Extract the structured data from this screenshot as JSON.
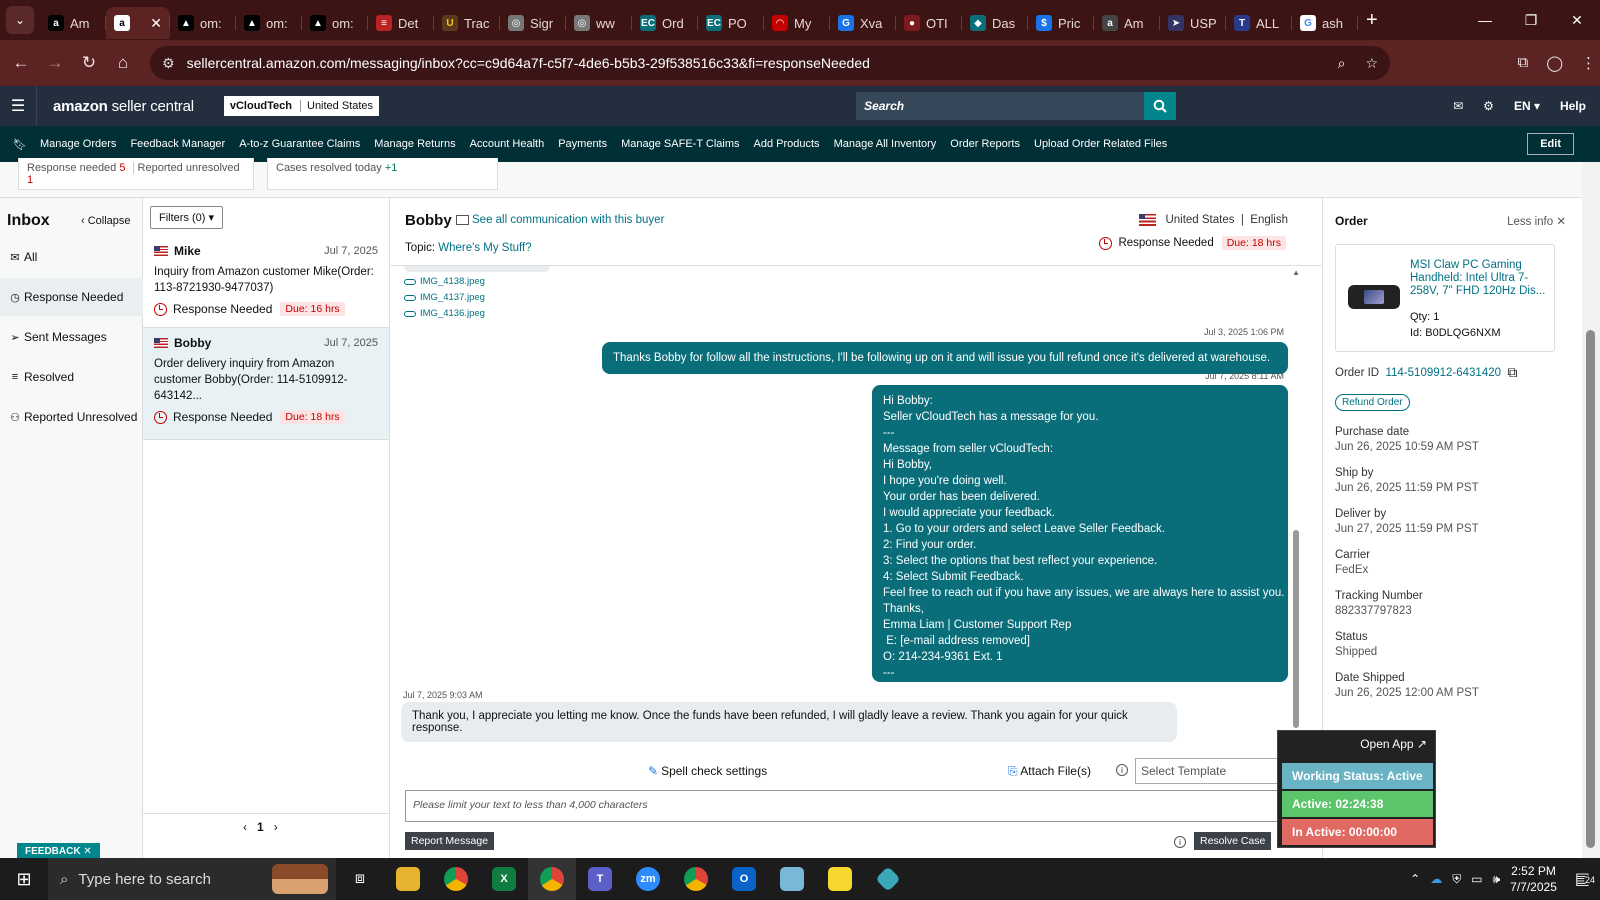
{
  "browser": {
    "tabs": [
      {
        "label": "Am",
        "fav": "a",
        "favbg": "#000",
        "favfg": "#fff"
      },
      {
        "label": "",
        "fav": "a",
        "favbg": "#fff",
        "favfg": "#000",
        "active": true
      },
      {
        "label": "om:",
        "fav": "▲",
        "favbg": "#000",
        "favfg": "#fff"
      },
      {
        "label": "om:",
        "fav": "▲",
        "favbg": "#000",
        "favfg": "#fff"
      },
      {
        "label": "om:",
        "fav": "▲",
        "favbg": "#000",
        "favfg": "#fff"
      },
      {
        "label": "Det",
        "fav": "≡",
        "favbg": "#b22",
        "favfg": "#fff"
      },
      {
        "label": "Trac",
        "fav": "U",
        "favbg": "#5a3a1a",
        "favfg": "#f4c430"
      },
      {
        "label": "Sigr",
        "fav": "◎",
        "favbg": "#777",
        "favfg": "#fff"
      },
      {
        "label": "ww",
        "fav": "◎",
        "favbg": "#777",
        "favfg": "#fff"
      },
      {
        "label": "Ord",
        "fav": "EC",
        "favbg": "#0a6e7a",
        "favfg": "#fff"
      },
      {
        "label": "PO",
        "fav": "EC",
        "favbg": "#0a6e7a",
        "favfg": "#fff"
      },
      {
        "label": "My",
        "fav": "◠",
        "favbg": "#c40000",
        "favfg": "#fff"
      },
      {
        "label": "Xva",
        "fav": "G",
        "favbg": "#1a73e8",
        "favfg": "#fff"
      },
      {
        "label": "OTI",
        "fav": "●",
        "favbg": "#7a1a1a",
        "favfg": "#fff"
      },
      {
        "label": "Das",
        "fav": "◆",
        "favbg": "#0a6e7a",
        "favfg": "#fff"
      },
      {
        "label": "Pric",
        "fav": "$",
        "favbg": "#1a73e8",
        "favfg": "#fff"
      },
      {
        "label": "Am",
        "fav": "a",
        "favbg": "#444",
        "favfg": "#fff"
      },
      {
        "label": "USP",
        "fav": "➤",
        "favbg": "#333366",
        "favfg": "#fff"
      },
      {
        "label": "ALL",
        "fav": "T",
        "favbg": "#2a3a8a",
        "favfg": "#fff"
      },
      {
        "label": "ash",
        "fav": "G",
        "favbg": "#fff",
        "favfg": "#4285f4"
      }
    ],
    "url": "sellercentral.amazon.com/messaging/inbox?cc=c9d64a7f-c5f7-4de6-b5b3-29f538516c33&fi=responseNeeded"
  },
  "header": {
    "logo_main": "amazon",
    "logo_sub": "seller central",
    "account_name": "vCloudTech",
    "account_region": "United States",
    "search_placeholder": "Search",
    "lang": "EN",
    "help": "Help"
  },
  "nav": {
    "items": [
      "Manage Orders",
      "Feedback Manager",
      "A-to-z Guarantee Claims",
      "Manage Returns",
      "Account Health",
      "Payments",
      "Manage SAFE-T Claims",
      "Add Products",
      "Manage All Inventory",
      "Order Reports",
      "Upload Order Related Files"
    ],
    "edit": "Edit"
  },
  "summary": {
    "response_needed": "Response needed",
    "response_needed_count": "5",
    "reported_unresolved": "Reported unresolved",
    "reported_unresolved_count": "1",
    "cases_resolved": "Cases resolved today",
    "cases_resolved_count": "+1"
  },
  "inbox": {
    "title": "Inbox",
    "collapse": "Collapse",
    "folders": [
      "All",
      "Response Needed",
      "Sent Messages",
      "Resolved",
      "Reported Unresolved"
    ],
    "filters": "Filters (0)",
    "messages": [
      {
        "name": "Mike",
        "date": "Jul 7, 2025",
        "preview": "Inquiry from Amazon customer Mike(Order: 113-8721930-9477037)",
        "status": "Response Needed",
        "due": "Due: 16 hrs"
      },
      {
        "name": "Bobby",
        "date": "Jul 7, 2025",
        "preview": "Order delivery inquiry from Amazon customer Bobby(Order: 114-5109912-643142...",
        "status": "Response Needed",
        "due": "Due: 18 hrs"
      }
    ],
    "page": "1"
  },
  "conversation": {
    "buyer": "Bobby",
    "see_all": "See all communication with this buyer",
    "topic_label": "Topic:",
    "topic": "Where's My Stuff?",
    "country": "United States",
    "language": "English",
    "status": "Response Needed",
    "due": "Due: 18 hrs",
    "attachments": [
      "IMG_4138.jpeg",
      "IMG_4137.jpeg",
      "IMG_4136.jpeg"
    ],
    "ts1": "Jul 3, 2025 1:06 PM",
    "msg1": "Thanks Bobby for follow all the instructions, I'll be following up on it and will issue you full refund once it's delivered at warehouse.",
    "ts2": "Jul 7, 2025 8:11 AM",
    "msg2_lines": [
      "Hi Bobby:",
      "Seller vCloudTech has a message for you.",
      "---",
      "Message from seller vCloudTech:",
      "Hi Bobby,",
      "I hope you're doing well.",
      "Your order has been delivered.",
      "I would appreciate your feedback.",
      "1. Go to your orders and select Leave Seller Feedback.",
      "2: Find your order.",
      "3: Select the options that best reflect your experience.",
      "4: Select Submit Feedback.",
      "Feel free to reach out if you have any issues, we are always here to assist you.",
      "Thanks,",
      "Emma Liam | Customer Support Rep",
      " E: [e-mail address removed]",
      "O: 214-234-9361 Ext. 1",
      "---"
    ],
    "ts3": "Jul 7, 2025 9:03 AM",
    "msg3": "Thank you, I appreciate you letting me know. Once the funds have been refunded, I will gladly leave a review. Thank you again for your quick response.",
    "spell_check": "Spell check settings",
    "attach_files": "Attach File(s)",
    "template_placeholder": "Select Template",
    "textbox_placeholder": "Please limit your text to less than 4,000 characters",
    "report": "Report Message",
    "resolve": "Resolve Case"
  },
  "order": {
    "title": "Order",
    "less_info": "Less info",
    "product_name": "MSI Claw PC Gaming Handheld: Intel Ultra 7-258V, 7\" FHD 120Hz Dis...",
    "qty": "Qty: 1",
    "asin": "Id: B0DLQG6NXM",
    "order_id_label": "Order ID",
    "order_id": "114-5109912-6431420",
    "refund": "Refund Order",
    "fields": [
      {
        "label": "Purchase date",
        "value": "Jun 26, 2025 10:59 AM PST"
      },
      {
        "label": "Ship by",
        "value": "Jun 26, 2025 11:59 PM PST"
      },
      {
        "label": "Deliver by",
        "value": "Jun 27, 2025 11:59 PM PST"
      },
      {
        "label": "Carrier",
        "value": "FedEx"
      },
      {
        "label": "Tracking Number",
        "value": "882337797823"
      },
      {
        "label": "Status",
        "value": "Shipped"
      },
      {
        "label": "Date Shipped",
        "value": "Jun 26, 2025 12:00 AM PST"
      }
    ]
  },
  "widget": {
    "open_app": "Open App ↗",
    "working": "Working Status: Active",
    "active": "Active: 02:24:38",
    "inactive": "In Active: 00:00:00"
  },
  "feedback": "FEEDBACK",
  "taskbar": {
    "search_placeholder": "Type here to search",
    "time": "2:52 PM",
    "date": "7/7/2025",
    "notifications": "24"
  },
  "colors": {
    "teal": "#0a6e7a",
    "link": "#007185",
    "due_bg": "#fde4e4",
    "alert": "#c40000"
  }
}
